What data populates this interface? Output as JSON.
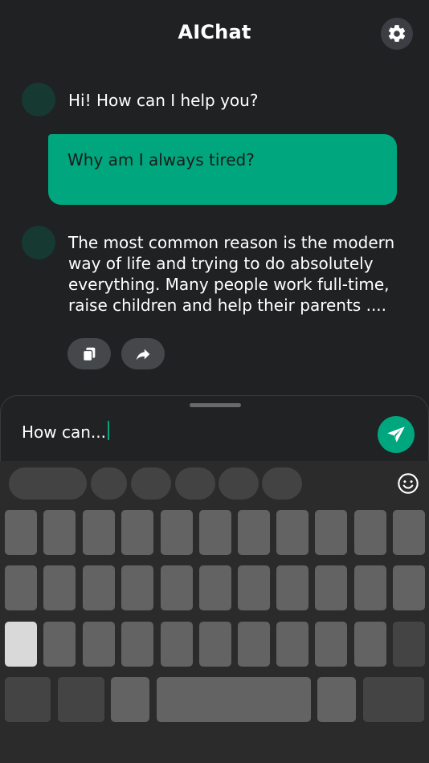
{
  "header": {
    "title": "AIChat",
    "settings_icon": "gear-icon"
  },
  "messages": [
    {
      "role": "assistant",
      "text": "Hi! How can I help you?"
    },
    {
      "role": "user",
      "text": "Why am I always tired?"
    },
    {
      "role": "assistant",
      "text": "The most common reason is the modern way of life and trying to do absolutely everything. Many people work full-time, raise children and help their parents ...."
    }
  ],
  "actions": {
    "copy_icon": "copy-icon",
    "share_icon": "share-icon"
  },
  "composer": {
    "value": "How can...",
    "send_icon": "send-icon"
  },
  "colors": {
    "accent": "#00a67e",
    "background": "#1f2123",
    "avatar": "#163a31",
    "keyboard": "#2b2b2b"
  }
}
